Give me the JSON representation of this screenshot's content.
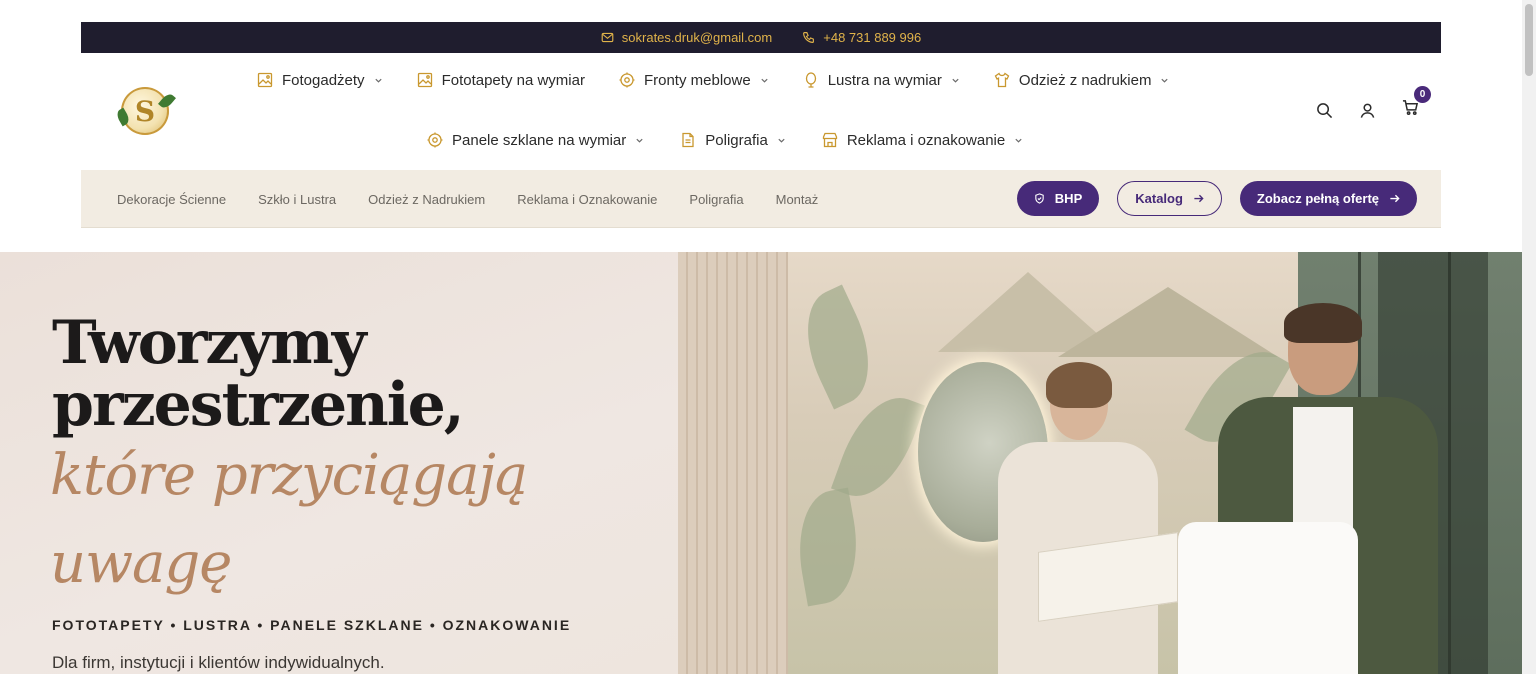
{
  "topbar": {
    "email": "sokrates.druk@gmail.com",
    "phone": "+48 731 889 996"
  },
  "brand": {
    "logo_letter": "S"
  },
  "nav": {
    "row1": [
      {
        "label": "Fotogadżety",
        "icon": "image-icon",
        "has_dropdown": true
      },
      {
        "label": "Fototapety na wymiar",
        "icon": "image-icon",
        "has_dropdown": false
      },
      {
        "label": "Fronty meblowe",
        "icon": "target-icon",
        "has_dropdown": true
      },
      {
        "label": "Lustra na wymiar",
        "icon": "mirror-icon",
        "has_dropdown": true
      },
      {
        "label": "Odzież z nadrukiem",
        "icon": "shirt-icon",
        "has_dropdown": true
      }
    ],
    "row2": [
      {
        "label": "Panele szklane na wymiar",
        "icon": "target-icon",
        "has_dropdown": true
      },
      {
        "label": "Poligrafia",
        "icon": "document-icon",
        "has_dropdown": true
      },
      {
        "label": "Reklama i oznakowanie",
        "icon": "store-icon",
        "has_dropdown": true
      }
    ]
  },
  "header_icons": {
    "cart_count": "0"
  },
  "subnav": {
    "links": [
      "Dekoracje Ścienne",
      "Szkło i Lustra",
      "Odzież z Nadrukiem",
      "Reklama i Oznakowanie",
      "Poligrafia",
      "Montaż"
    ],
    "bhp_label": "BHP",
    "catalog_label": "Katalog",
    "offer_label": "Zobacz pełną ofertę"
  },
  "hero": {
    "title_line1": "Tworzymy",
    "title_line2": "przestrzenie,",
    "script_line1": "które przyciągają",
    "script_line2": "uwagę",
    "tags": "FOTOTAPETY • LUSTRA • PANELE SZKLANE • OZNAKOWANIE",
    "subtitle": "Dla firm, instytucji i klientów indywidualnych."
  },
  "colors": {
    "topbar_bg": "#1f1d2e",
    "topbar_text": "#e0b34a",
    "accent_purple": "#472a79",
    "subbar_bg": "#f2ece2",
    "script_color": "#b68764"
  }
}
